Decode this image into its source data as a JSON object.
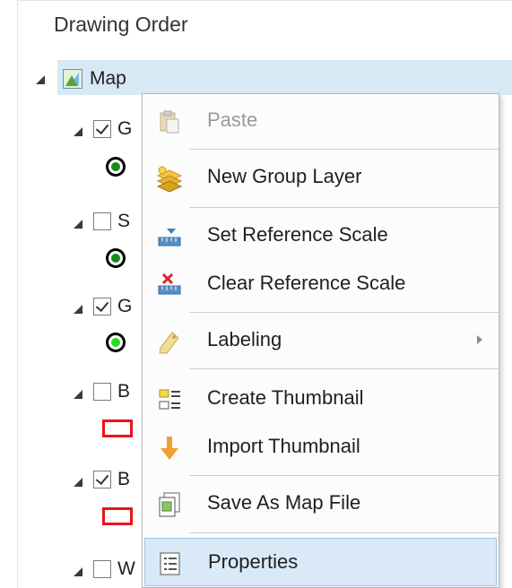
{
  "pane": {
    "title": "Drawing Order",
    "map_label": "Map",
    "layers": [
      {
        "letter": "G",
        "checked": true,
        "symbol": "point",
        "fill": "#1a8a1a"
      },
      {
        "letter": "S",
        "checked": false,
        "symbol": "point",
        "fill": "#1a8a1a"
      },
      {
        "letter": "G",
        "checked": true,
        "symbol": "point",
        "fill": "#22dd22"
      },
      {
        "letter": "B",
        "checked": false,
        "symbol": "polygon",
        "fill": "#e8141a"
      },
      {
        "letter": "B",
        "checked": true,
        "symbol": "polygon",
        "fill": "#e8141a"
      },
      {
        "letter": "W",
        "checked": false,
        "symbol": "none",
        "fill": ""
      }
    ]
  },
  "context_menu": {
    "items": [
      {
        "label": "Paste",
        "icon": "paste-icon",
        "enabled": false
      },
      {
        "label": "New Group Layer",
        "icon": "group-layer-icon",
        "enabled": true
      },
      {
        "label": "Set Reference Scale",
        "icon": "set-scale-icon",
        "enabled": true
      },
      {
        "label": "Clear Reference Scale",
        "icon": "clear-scale-icon",
        "enabled": true
      },
      {
        "label": "Labeling",
        "icon": "labeling-icon",
        "enabled": true,
        "has_submenu": true
      },
      {
        "label": "Create Thumbnail",
        "icon": "create-thumbnail-icon",
        "enabled": true
      },
      {
        "label": "Import Thumbnail",
        "icon": "import-thumbnail-icon",
        "enabled": true
      },
      {
        "label": "Save As Map File",
        "icon": "save-map-file-icon",
        "enabled": true
      },
      {
        "label": "Properties",
        "icon": "properties-icon",
        "enabled": true,
        "highlighted": true
      }
    ]
  },
  "colors": {
    "selection": "#d8e9f6",
    "menu_highlight": "#d9e9f7",
    "accent_orange": "#f0a030"
  }
}
